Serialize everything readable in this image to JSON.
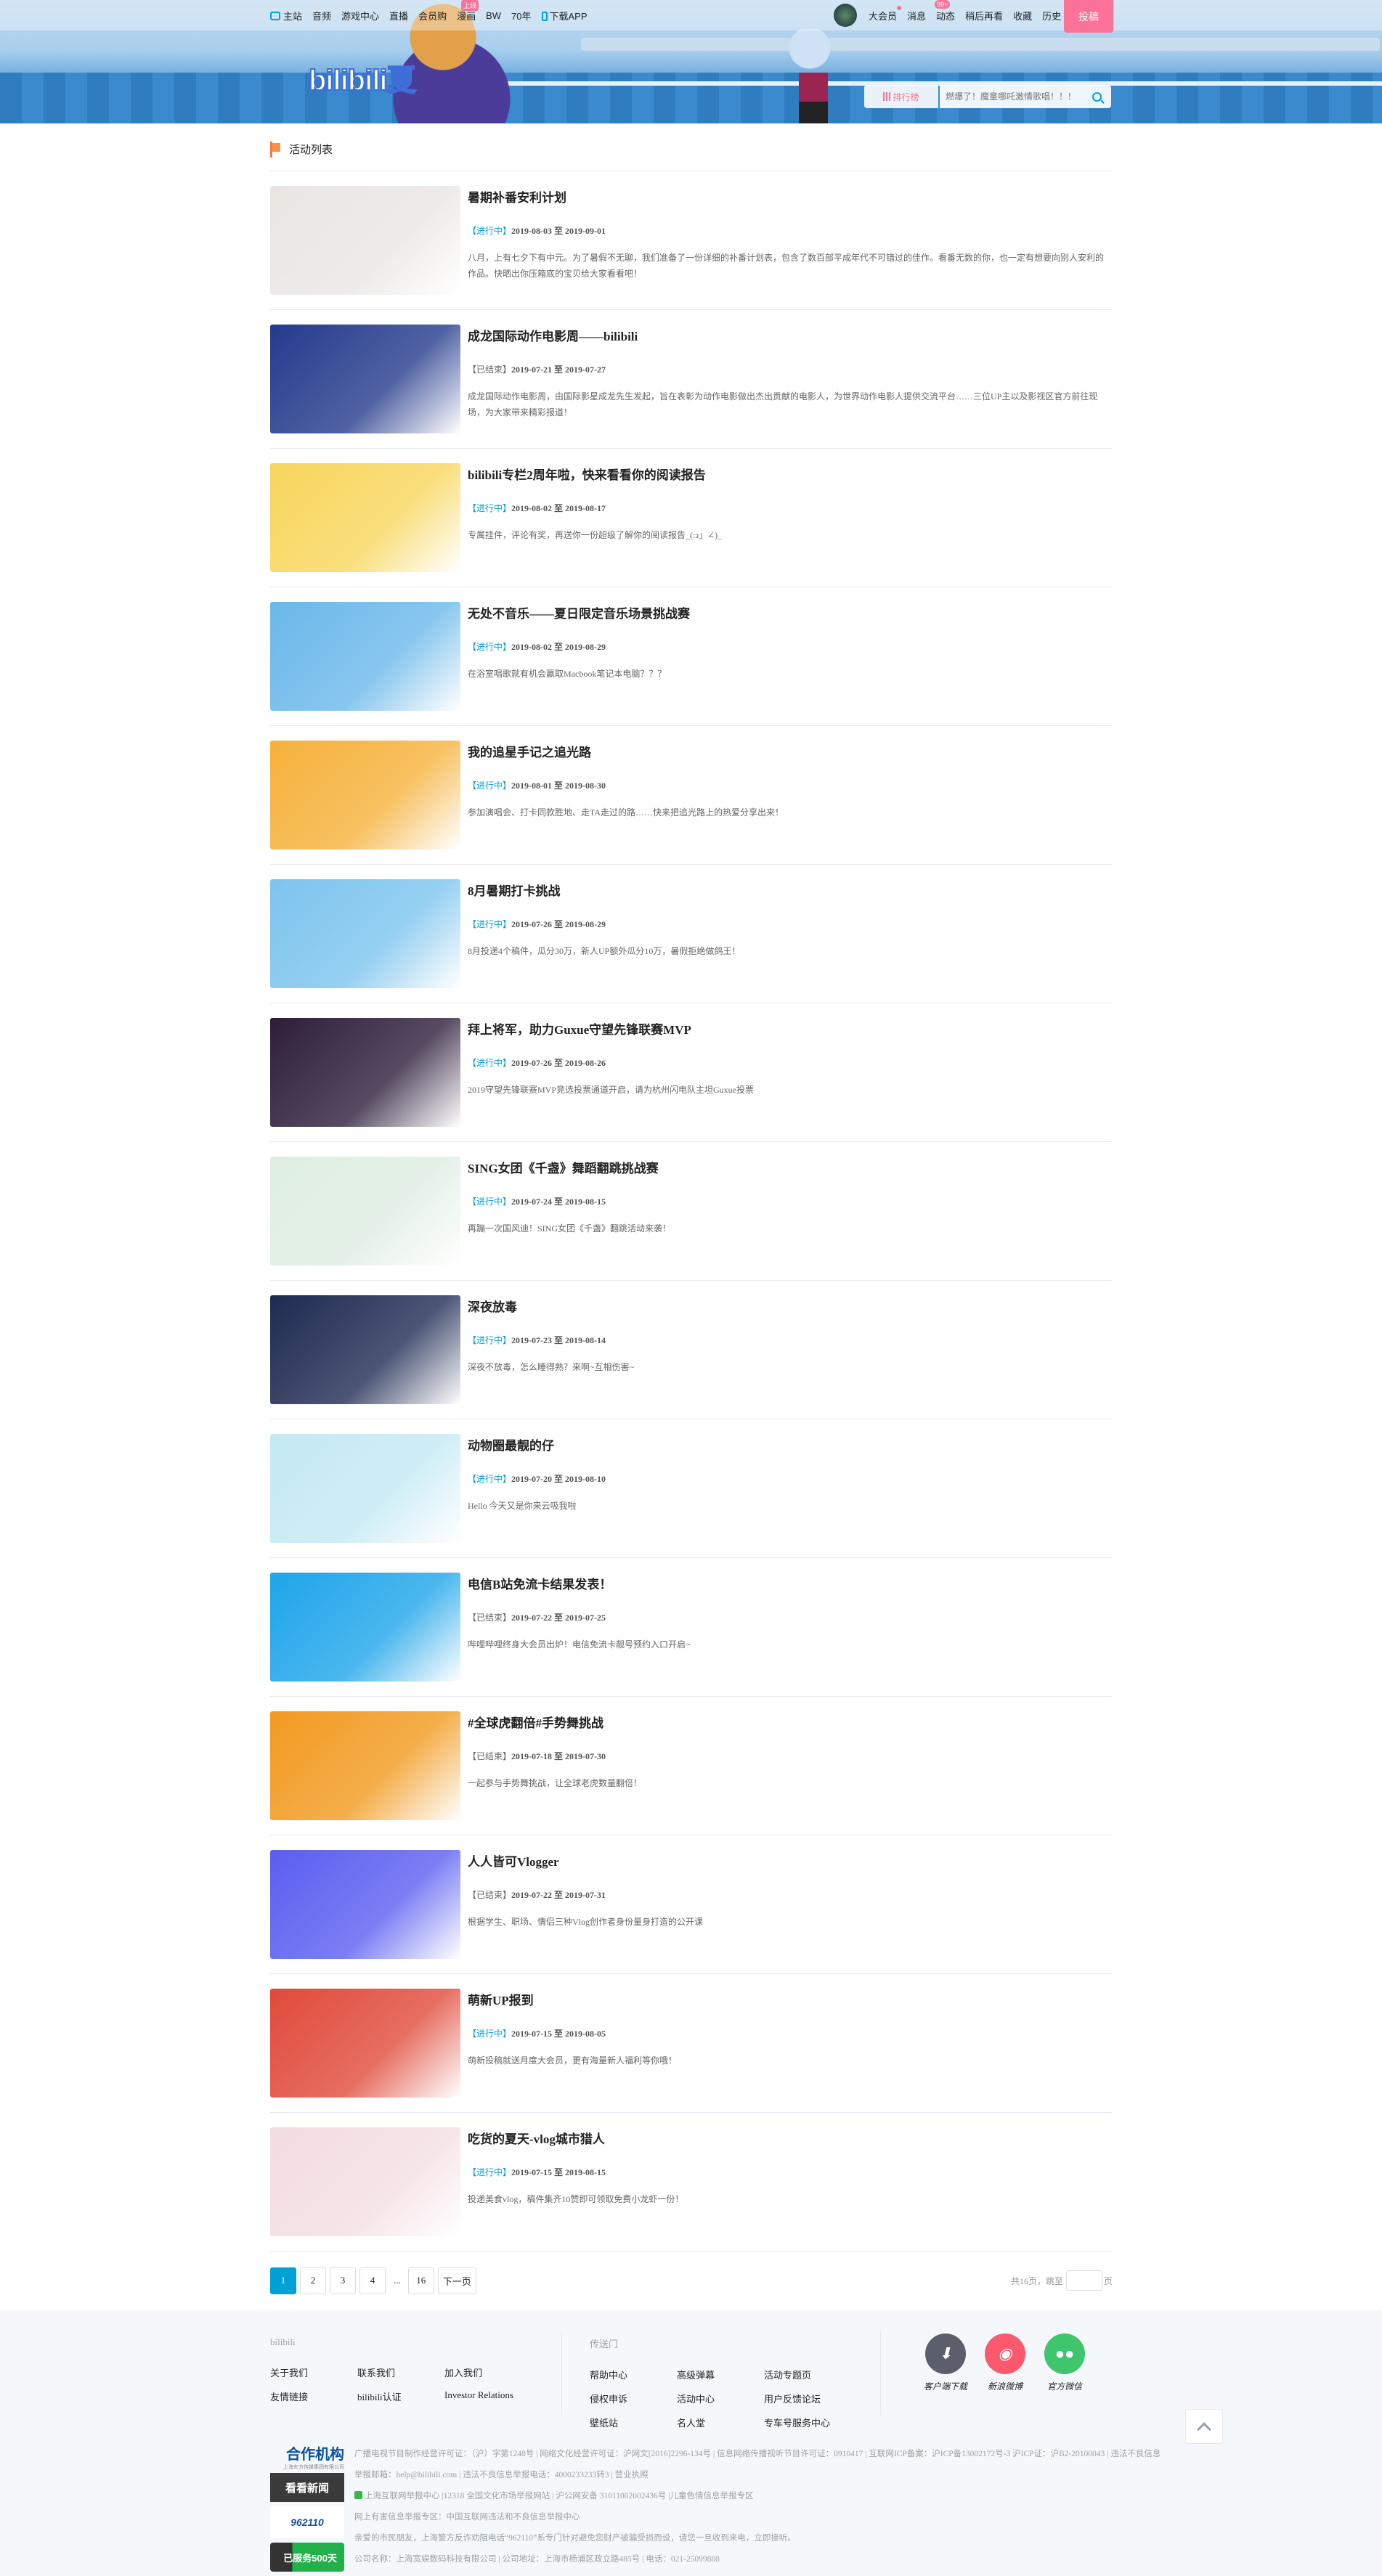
{
  "nav": {
    "left": [
      {
        "label": "主站",
        "icon": "tv-icon"
      },
      {
        "label": "音频"
      },
      {
        "label": "游戏中心"
      },
      {
        "label": "直播"
      },
      {
        "label": "会员购"
      },
      {
        "label": "漫画",
        "badge": "上线"
      },
      {
        "label": "BW"
      },
      {
        "label": "70年"
      },
      {
        "label": "下载APP",
        "icon": "phone-icon"
      }
    ],
    "right": [
      {
        "label": "大会员"
      },
      {
        "label": "消息"
      },
      {
        "label": "动态",
        "badge": "99+"
      },
      {
        "label": "稍后再看"
      },
      {
        "label": "收藏"
      },
      {
        "label": "历史"
      }
    ],
    "upload_label": "投稿"
  },
  "banner": {
    "logo": "bilibili夏"
  },
  "search": {
    "rank_label": "排行榜",
    "placeholder": "燃爆了！魔童哪吒激情歌唱！！！"
  },
  "list_title": "活动列表",
  "status_labels": {
    "ongoing": "【进行中】",
    "ended": "【已结束】"
  },
  "date_separator": "至",
  "items": [
    {
      "title": "暑期补番安利计划",
      "status": "ongoing",
      "start": "2019-08-03",
      "end": "2019-09-01",
      "desc": "八月，上有七夕下有中元。为了暑假不无聊，我们准备了一份详细的补番计划表，包含了数百部平成年代不可错过的佳作。看番无数的你，也一定有想要向别人安利的作品。快晒出你压箱底的宝贝给大家看看吧！",
      "color": "#e9e6e2"
    },
    {
      "title": "成龙国际动作电影周——bilibili",
      "status": "ended",
      "start": "2019-07-21",
      "end": "2019-07-27",
      "desc": "成龙国际动作电影周，由国际影星成龙先生发起，旨在表彰为动作电影做出杰出贡献的电影人，为世界动作电影人提供交流平台……三位UP主以及影视区官方前往现场，为大家带来精彩报道！",
      "color": "#243a8c"
    },
    {
      "title": "bilibili专栏2周年啦，快来看看你的阅读报告",
      "status": "ongoing",
      "start": "2019-08-02",
      "end": "2019-08-17",
      "desc": "专属挂件，评论有奖，再送你一份超级了解你的阅读报告_(:з」∠)_",
      "color": "#f8d65c"
    },
    {
      "title": "无处不音乐——夏日限定音乐场景挑战赛",
      "status": "ongoing",
      "start": "2019-08-02",
      "end": "2019-08-29",
      "desc": "在浴室唱歌就有机会赢取Macbook笔记本电脑？？？",
      "color": "#6ab8ea"
    },
    {
      "title": "我的追星手记之追光路",
      "status": "ongoing",
      "start": "2019-08-01",
      "end": "2019-08-30",
      "desc": "参加演唱会、打卡同款胜地、走TA走过的路……快来把追光路上的热爱分享出来！",
      "color": "#f6b13a"
    },
    {
      "title": "8月暑期打卡挑战",
      "status": "ongoing",
      "start": "2019-07-26",
      "end": "2019-08-29",
      "desc": "8月投递4个稿件，瓜分30万，新人UP额外瓜分10万，暑假拒绝做鸽王！",
      "color": "#7cc4ee"
    },
    {
      "title": "拜上将军，助力Guxue守望先锋联赛MVP",
      "status": "ongoing",
      "start": "2019-07-26",
      "end": "2019-08-26",
      "desc": "2019守望先锋联赛MVP竞选投票通道开启，请为杭州闪电队主坦Guxue投票",
      "color": "#2d1d3a"
    },
    {
      "title": "SING女团《千盏》舞蹈翻跳挑战赛",
      "status": "ongoing",
      "start": "2019-07-24",
      "end": "2019-08-15",
      "desc": "再蹦一次国风迪！SING女团《千盏》翻跳活动来袭！",
      "color": "#dfeee2"
    },
    {
      "title": "深夜放毒",
      "status": "ongoing",
      "start": "2019-07-23",
      "end": "2019-08-14",
      "desc": "深夜不放毒，怎么睡得熟？来啊~互相伤害~",
      "color": "#1e2a52"
    },
    {
      "title": "动物圈最靓的仔",
      "status": "ongoing",
      "start": "2019-07-20",
      "end": "2019-08-10",
      "desc": "Hello 今天又是你来云吸我啦",
      "color": "#c4e9f4"
    },
    {
      "title": "电信B站免流卡结果发表！",
      "status": "ended",
      "start": "2019-07-22",
      "end": "2019-07-25",
      "desc": "哔哩哔哩终身大会员出炉！电信免流卡靓号预约入口开启~",
      "color": "#1ea5ea"
    },
    {
      "title": "#全球虎翻倍#手势舞挑战",
      "status": "ended",
      "start": "2019-07-18",
      "end": "2019-07-30",
      "desc": "一起参与手势舞挑战，让全球老虎数量翻倍！",
      "color": "#f29a1f"
    },
    {
      "title": "人人皆可Vlogger",
      "status": "ended",
      "start": "2019-07-22",
      "end": "2019-07-31",
      "desc": "根据学生、职场、情侣三种Vlog创作者身份量身打造的公开课",
      "color": "#5a5ef0"
    },
    {
      "title": "萌新UP报到",
      "status": "ongoing",
      "start": "2019-07-15",
      "end": "2019-08-05",
      "desc": "萌新投稿就送月度大会员，更有海量新人福利等你哦！",
      "color": "#e04a3a"
    },
    {
      "title": "吃货的夏天-vlog城市猎人",
      "status": "ongoing",
      "start": "2019-07-15",
      "end": "2019-08-15",
      "desc": "投递美食vlog，稿件集齐10赞即可领取免费小龙虾一份！",
      "color": "#f3dde2"
    }
  ],
  "pagination": {
    "current": "1",
    "pages": [
      "2",
      "3",
      "4"
    ],
    "ellipsis": "...",
    "last": "16",
    "next": "下一页",
    "total_text": "共16页，跳至",
    "page_suffix": "页"
  },
  "footer": {
    "col1": {
      "title": "bilibili",
      "links": [
        "关于我们",
        "联系我们",
        "加入我们",
        "友情链接",
        "bilibili认证",
        "Investor Relations"
      ]
    },
    "col2": {
      "title": "传送门",
      "links": [
        "帮助中心",
        "高级弹幕",
        "活动专题页",
        "侵权申诉",
        "活动中心",
        "用户反馈论坛",
        "壁纸站",
        "名人堂",
        "专车号服务中心"
      ]
    },
    "social": [
      {
        "label": "客户端下载",
        "color": "#5a5f6b",
        "icon": "download-icon"
      },
      {
        "label": "新浪微博",
        "color": "#fb5a6e",
        "icon": "weibo-icon"
      },
      {
        "label": "官方微信",
        "color": "#3fc66c",
        "icon": "wechat-icon"
      }
    ],
    "partners": {
      "title": "合作机构",
      "subtitle": "上海东方传媒集团有限公司",
      "kankan": "看看新闻",
      "p962110": "962110",
      "served": "已服务500天"
    },
    "legal": [
      "广播电视节目制作经营许可证：（沪）字第1248号 | 网络文化经营许可证：沪网文[2016]2296-134号 | 信息网络传播视听节目许可证：0910417 | 互联网ICP备案：沪ICP备13002172号-3 沪ICP证：沪B2-20100043 | 违法不良信息举报邮箱：help@bilibili.com | 违法不良信息举报电话：4000233233转3 | 营业执照",
      "上海互联网举报中心 |12318 全国文化市场举报网站 | 沪公网安备 31011002002436号 |儿童色情信息举报专区",
      "网上有害信息举报专区：中国互联网违法和不良信息举报中心",
      "亲爱的市民朋友，上海警方反诈劝阻电话“962110”系专门针对避免您财产被骗受损而设，请您一旦收到来电，立即接听。",
      "公司名称：上海宽娱数码科技有限公司 | 公司地址：上海市杨浦区政立路485号 | 电话：021-25099888"
    ]
  },
  "colors": {
    "accent": "#00a1d6",
    "pink": "#fb7299"
  }
}
